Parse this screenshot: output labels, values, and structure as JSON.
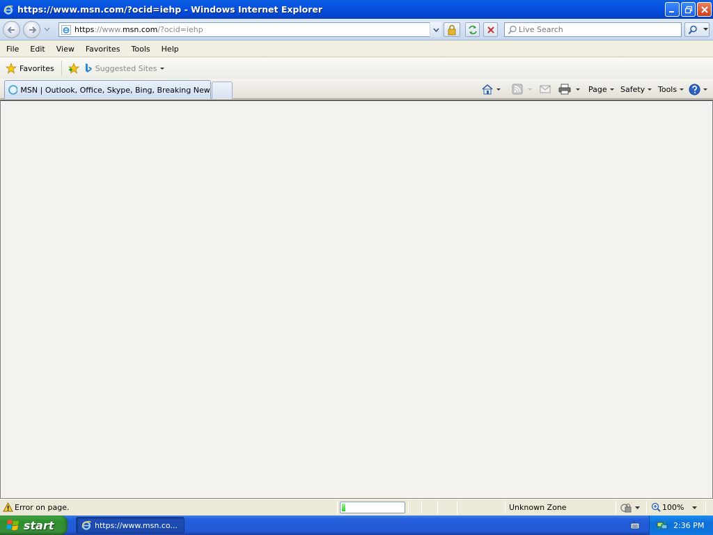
{
  "window": {
    "title": "https://www.msn.com/?ocid=iehp - Windows Internet Explorer"
  },
  "address_bar": {
    "url_scheme": "https",
    "url_sep": "://",
    "url_host_pre": "www.",
    "url_host": "msn.com",
    "url_rest": "/?ocid=iehp"
  },
  "search": {
    "placeholder": "Live Search"
  },
  "menu": [
    "File",
    "Edit",
    "View",
    "Favorites",
    "Tools",
    "Help"
  ],
  "favorites_bar": {
    "favorites_label": "Favorites",
    "suggested_label": "Suggested Sites"
  },
  "tabs": [
    {
      "title": "MSN | Outlook, Office, Skype, Bing, Breaking News, a..."
    }
  ],
  "command_bar": {
    "page_label": "Page",
    "safety_label": "Safety",
    "tools_label": "Tools"
  },
  "status_bar": {
    "status_text": "Error on page.",
    "progress_fraction": 0.06,
    "zone_text": "Unknown Zone",
    "zoom_text": "100%"
  },
  "taskbar": {
    "start_label": "start",
    "task_item_label": "https://www.msn.co...",
    "clock": "2:36 PM"
  },
  "colors": {
    "titlebar_blue": "#0550e0",
    "start_green": "#388e38",
    "progress_green": "#2ecb20"
  }
}
